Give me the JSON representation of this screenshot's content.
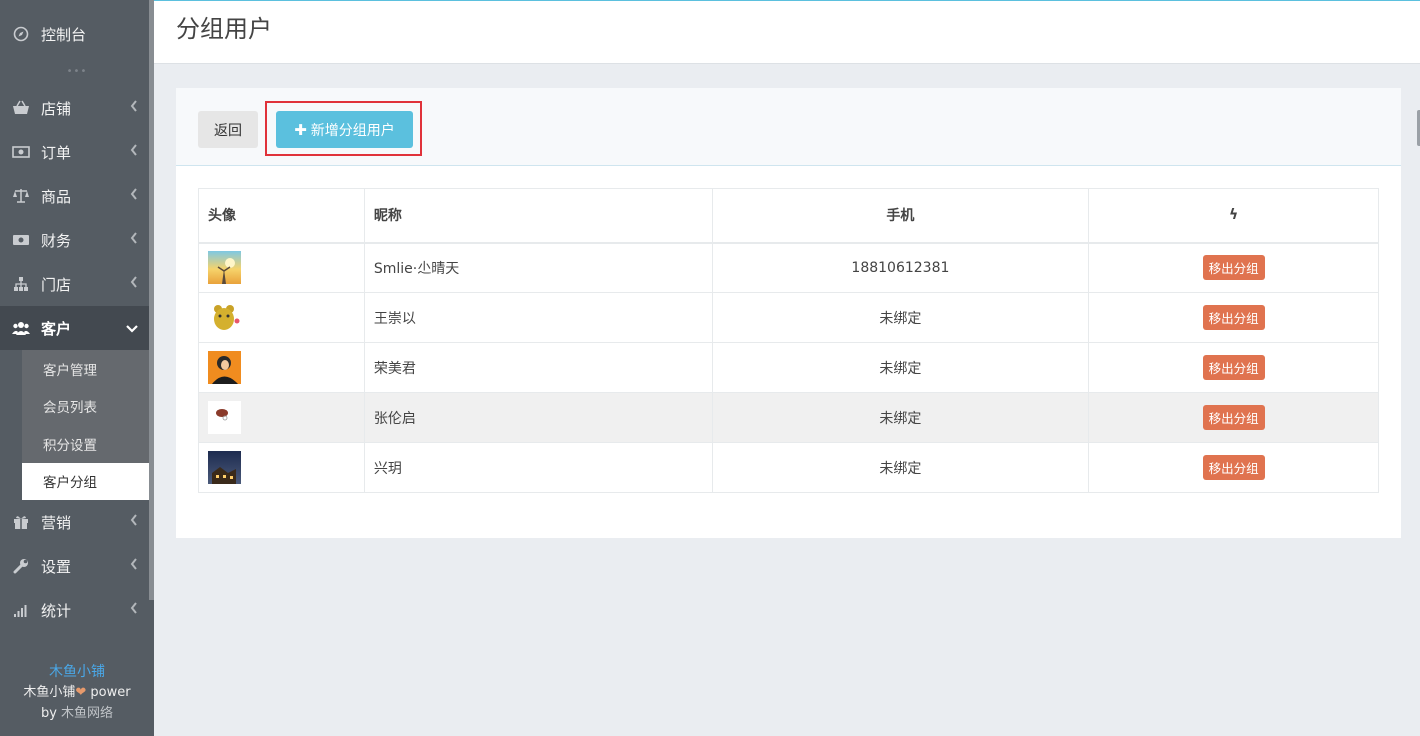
{
  "sidebar": {
    "items": [
      {
        "label": "控制台",
        "icon": "compass-icon"
      },
      {
        "label": "店铺",
        "icon": "basket-icon"
      },
      {
        "label": "订单",
        "icon": "money-icon"
      },
      {
        "label": "商品",
        "icon": "balance-scale-icon"
      },
      {
        "label": "财务",
        "icon": "cash-icon"
      },
      {
        "label": "门店",
        "icon": "sitemap-icon"
      },
      {
        "label": "客户",
        "icon": "users-icon"
      },
      {
        "label": "营销",
        "icon": "gift-icon"
      },
      {
        "label": "设置",
        "icon": "wrench-icon"
      },
      {
        "label": "统计",
        "icon": "signal-icon"
      }
    ],
    "sub_items": [
      "客户管理",
      "会员列表",
      "积分设置",
      "客户分组"
    ],
    "footer": {
      "brand": "木鱼小铺",
      "power_pre": "木鱼小铺",
      "heart": "❤",
      "power_post": " power",
      "by": "by ",
      "company": "木鱼网络"
    }
  },
  "header": {
    "title": "分组用户"
  },
  "toolbar": {
    "back_label": "返回",
    "add_label": "新增分组用户"
  },
  "table": {
    "headers": {
      "avatar": "头像",
      "nickname": "昵称",
      "phone": "手机",
      "action": "ϟ"
    },
    "rows": [
      {
        "nickname": "Smlie·尐晴天",
        "phone": "18810612381",
        "action": "移出分组"
      },
      {
        "nickname": "王崇以",
        "phone": "未绑定",
        "action": "移出分组"
      },
      {
        "nickname": "荣美君",
        "phone": "未绑定",
        "action": "移出分组"
      },
      {
        "nickname": "张伦启",
        "phone": "未绑定",
        "action": "移出分组"
      },
      {
        "nickname": "兴玥",
        "phone": "未绑定",
        "action": "移出分组"
      }
    ]
  },
  "colors": {
    "accent": "#5bc0de",
    "danger": "#e0734f",
    "sidebar": "#555c63",
    "highlight": "#e0323a"
  }
}
